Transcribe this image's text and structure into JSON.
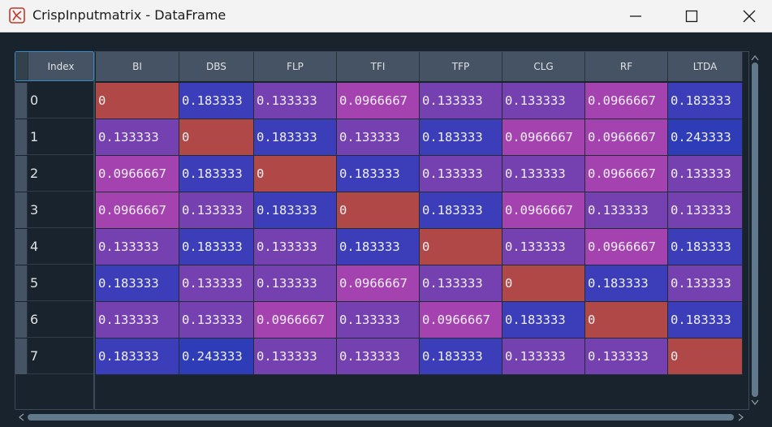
{
  "window": {
    "title": "CrispInputmatrix - DataFrame"
  },
  "table": {
    "index_header": "Index",
    "columns": [
      "BI",
      "DBS",
      "FLP",
      "TFI",
      "TFP",
      "CLG",
      "RF",
      "LTDA"
    ],
    "index": [
      "0",
      "1",
      "2",
      "3",
      "4",
      "5",
      "6",
      "7"
    ],
    "rows": [
      [
        "0",
        "0.183333",
        "0.133333",
        "0.0966667",
        "0.133333",
        "0.133333",
        "0.0966667",
        "0.183333"
      ],
      [
        "0.133333",
        "0",
        "0.183333",
        "0.133333",
        "0.183333",
        "0.0966667",
        "0.0966667",
        "0.243333"
      ],
      [
        "0.0966667",
        "0.183333",
        "0",
        "0.183333",
        "0.133333",
        "0.133333",
        "0.0966667",
        "0.133333"
      ],
      [
        "0.0966667",
        "0.133333",
        "0.183333",
        "0",
        "0.183333",
        "0.0966667",
        "0.133333",
        "0.133333"
      ],
      [
        "0.133333",
        "0.183333",
        "0.133333",
        "0.183333",
        "0",
        "0.133333",
        "0.0966667",
        "0.183333"
      ],
      [
        "0.183333",
        "0.133333",
        "0.133333",
        "0.0966667",
        "0.133333",
        "0",
        "0.183333",
        "0.133333"
      ],
      [
        "0.133333",
        "0.133333",
        "0.0966667",
        "0.133333",
        "0.0966667",
        "0.183333",
        "0",
        "0.183333"
      ],
      [
        "0.183333",
        "0.243333",
        "0.133333",
        "0.133333",
        "0.183333",
        "0.133333",
        "0.133333",
        "0"
      ]
    ]
  },
  "colors": {
    "zero": "#b04848",
    "v0966667": "#a442b0",
    "v133333": "#7540b0",
    "v183333": "#3c3db8",
    "v243333": "#2e3cb8"
  }
}
